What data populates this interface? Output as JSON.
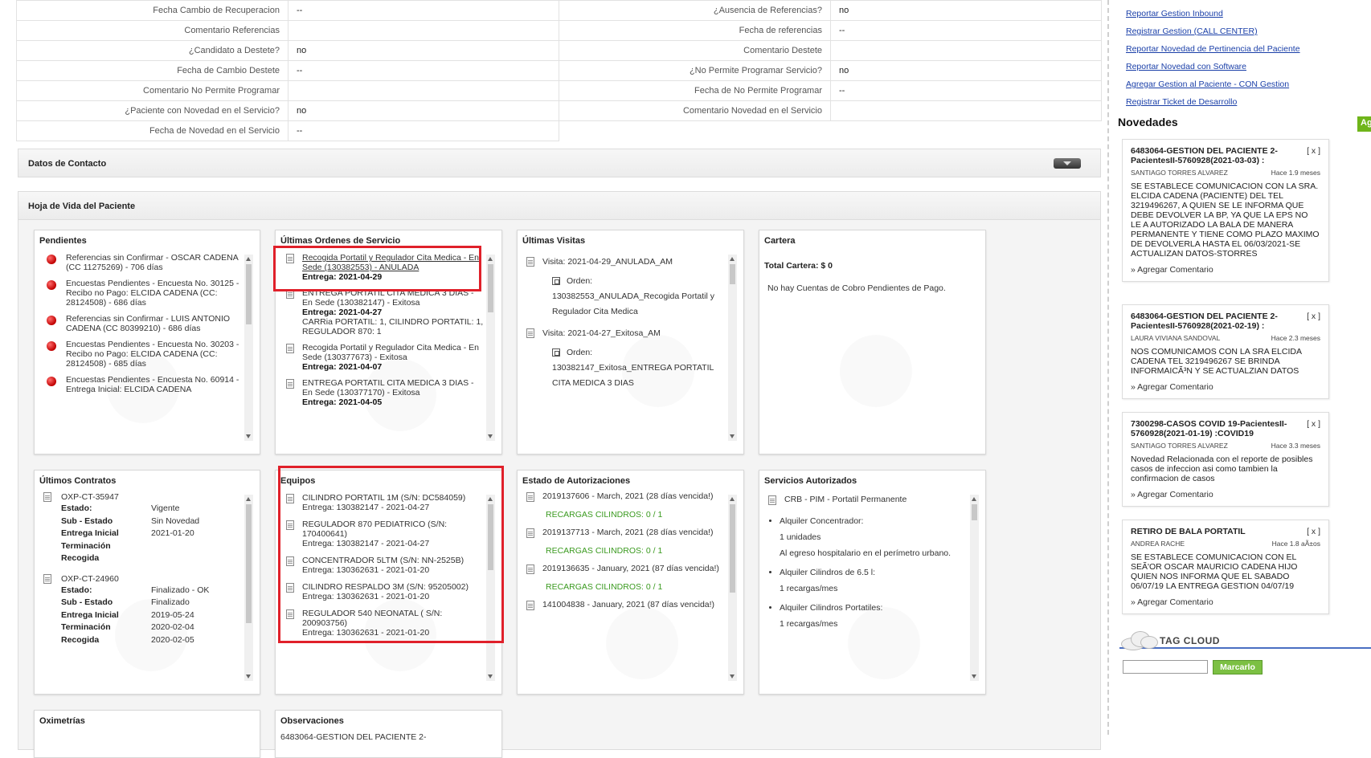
{
  "info_rows": [
    {
      "l1": "Fecha Cambio de Recuperacion",
      "v1": "--",
      "l2": "¿Ausencia de Referencias?",
      "v2": "no"
    },
    {
      "l1": "Comentario Referencias",
      "v1": "",
      "l2": "Fecha de referencias",
      "v2": "--"
    },
    {
      "l1": "¿Candidato a Destete?",
      "v1": "no",
      "l2": "Comentario Destete",
      "v2": ""
    },
    {
      "l1": "Fecha de Cambio Destete",
      "v1": "--",
      "l2": "¿No Permite Programar Servicio?",
      "v2": "no"
    },
    {
      "l1": "Comentario No Permite Programar",
      "v1": "",
      "l2": "Fecha de No Permite Programar",
      "v2": "--"
    },
    {
      "l1": "¿Paciente con Novedad en el Servicio?",
      "v1": "no",
      "l2": "Comentario Novedad en el Servicio",
      "v2": ""
    },
    {
      "l1": "Fecha de Novedad en el Servicio",
      "v1": "--"
    }
  ],
  "sections": {
    "datos_contacto": "Datos de Contacto",
    "hoja_vida": "Hoja de Vida del Paciente"
  },
  "pendientes": {
    "title": "Pendientes",
    "items": [
      "Referencias sin Confirmar - OSCAR CADENA (CC 11275269) - 706 días",
      "Encuestas Pendientes - Encuesta No. 30125 - Recibo no Pago: ELCIDA CADENA (CC: 28124508) - 686 días",
      "Referencias sin Confirmar - LUIS ANTONIO CADENA (CC 80399210) - 686 días",
      "Encuestas Pendientes - Encuesta No. 30203 - Recibo no Pago: ELCIDA CADENA (CC: 28124508) - 685 días",
      "Encuestas Pendientes - Encuesta No. 60914 - Entrega Inicial: ELCIDA CADENA"
    ]
  },
  "ordenes": {
    "title": "Últimas Ordenes de Servicio",
    "items": [
      {
        "desc": "Recogida Portatil y Regulador Cita Medica - En Sede (130382553) - ANULADA",
        "entrega": "Entrega: 2021-04-29",
        "extra": ""
      },
      {
        "desc": "ENTREGA PORTATIL CITA MEDICA 3 DIAS - En Sede (130382147) - Exitosa",
        "entrega": "Entrega: 2021-04-27",
        "extra": "CARRia PORTATIL: 1, CILINDRO PORTATIL: 1, REGULADOR 870: 1"
      },
      {
        "desc": "Recogida Portatil y Regulador Cita Medica - En Sede (130377673) - Exitosa",
        "entrega": "Entrega: 2021-04-07",
        "extra": ""
      },
      {
        "desc": "ENTREGA PORTATIL CITA MEDICA 3 DIAS - En Sede (130377170) - Exitosa",
        "entrega": "Entrega: 2021-04-05",
        "extra": ""
      }
    ]
  },
  "visitas": {
    "title": "Últimas Visitas",
    "items": [
      {
        "visita": "Visita: 2021-04-29_ANULADA_AM",
        "orden_label": "Orden:",
        "orden": "130382553_ANULADA_Recogida Portatil y Regulador Cita Medica"
      },
      {
        "visita": "Visita: 2021-04-27_Exitosa_AM",
        "orden_label": "Orden:",
        "orden": "130382147_Exitosa_ENTREGA PORTATIL CITA MEDICA 3 DIAS"
      }
    ]
  },
  "cartera": {
    "title": "Cartera",
    "total": "Total Cartera: $ 0",
    "msg": "No hay Cuentas de Cobro Pendientes de Pago."
  },
  "contratos": {
    "title": "Últimos Contratos",
    "items": [
      {
        "code": "OXP-CT-35947",
        "rows": [
          [
            "Estado:",
            "Vigente"
          ],
          [
            "Sub - Estado",
            "Sin Novedad"
          ],
          [
            "Entrega Inicial",
            "2021-01-20"
          ],
          [
            "Terminación",
            ""
          ],
          [
            "Recogida",
            ""
          ]
        ]
      },
      {
        "code": "OXP-CT-24960",
        "rows": [
          [
            "Estado:",
            "Finalizado - OK"
          ],
          [
            "Sub - Estado",
            "Finalizado"
          ],
          [
            "Entrega Inicial",
            "2019-05-24"
          ],
          [
            "Terminación",
            "2020-02-04"
          ],
          [
            "Recogida",
            "2020-02-05"
          ]
        ]
      }
    ]
  },
  "equipos": {
    "title": "Equipos",
    "items": [
      {
        "name": "CILINDRO PORTATIL 1M (S/N: DC584059)",
        "entrega": "Entrega: 130382147 - 2021-04-27"
      },
      {
        "name": "REGULADOR 870 PEDIATRICO (S/N: 170400641)",
        "entrega": "Entrega: 130382147 - 2021-04-27"
      },
      {
        "name": "CONCENTRADOR 5LTM (S/N: NN-2525B)",
        "entrega": "Entrega: 130362631 - 2021-01-20"
      },
      {
        "name": "CILINDRO RESPALDO 3M (S/N: 95205002)",
        "entrega": "Entrega: 130362631 - 2021-01-20"
      },
      {
        "name": "REGULADOR 540 NEONATAL ( S/N: 200903756)",
        "entrega": "Entrega: 130362631 - 2021-01-20"
      }
    ]
  },
  "autorizaciones": {
    "title": "Estado de Autorizaciones",
    "items": [
      {
        "text": "2019137606 - March, 2021 (28 días vencida!)",
        "recargas": "RECARGAS CILINDROS: 0 / 1"
      },
      {
        "text": "2019137713 - March, 2021 (28 días vencida!)",
        "recargas": "RECARGAS CILINDROS: 0 / 1"
      },
      {
        "text": "2019136635 - January, 2021 (87 días vencida!)",
        "recargas": "RECARGAS CILINDROS: 0 / 1"
      },
      {
        "text": "141004838 - January, 2021 (87 días vencida!)",
        "recargas": ""
      }
    ]
  },
  "servicios": {
    "title": "Servicios Autorizados",
    "header": "CRB - PIM - Portatil Permanente",
    "items": [
      {
        "name": "Alquiler Concentrador:",
        "lines": [
          "1 unidades",
          "Al egreso hospitalario en el perímetro urbano."
        ]
      },
      {
        "name": "Alquiler Cilindros de 6.5 l:",
        "lines": [
          "1 recargas/mes"
        ]
      },
      {
        "name": "Alquiler Cilindros Portatiles:",
        "lines": [
          "1 recargas/mes"
        ]
      }
    ]
  },
  "bottom_cards": {
    "oximetrias": "Oximetrías",
    "observaciones": "Observaciones",
    "observaciones_preview": "6483064-GESTION DEL PACIENTE 2-"
  },
  "links": [
    "Reportar Gestion Inbound",
    "Registrar Gestion (CALL CENTER)",
    "Reportar Novedad de Pertinencia del Paciente",
    "Reportar Novedad con Software",
    "Agregar Gestion al Paciente - CON Gestion",
    "Registrar Ticket de Desarrollo"
  ],
  "novedades": {
    "title": "Novedades",
    "add_label": "Ag",
    "close_label": "[ x ]",
    "comment_label": "» Agregar Comentario",
    "items": [
      {
        "title": "6483064-GESTION DEL PACIENTE 2-PacientesII-5760928(2021-03-03) :",
        "author": "SANTIAGO TORRES ALVAREZ",
        "ago": "Hace 1.9 meses",
        "body": "SE ESTABLECE COMUNICACION CON LA SRA. ELCIDA CADENA (PACIENTE) DEL TEL 3219496267, A QUIEN SE LE INFORMA QUE DEBE DEVOLVER LA BP, YA QUE LA EPS NO LE A AUTORIZADO LA BALA DE MANERA PERMANENTE Y TIENE COMO PLAZO MAXIMO DE DEVOLVERLA HASTA EL 06/03/2021-SE ACTUALIZAN DATOS-STORRES"
      },
      {
        "title": "6483064-GESTION DEL PACIENTE 2-PacientesII-5760928(2021-02-19) :",
        "author": "LAURA VIVIANA SANDOVAL",
        "ago": "Hace 2.3 meses",
        "body": "NOS COMUNICAMOS CON LA SRA ELCIDA CADENA TEL 3219496267 SE BRINDA INFORMAICÃ³N Y SE ACTUALZIAN DATOS"
      },
      {
        "title": "7300298-CASOS COVID 19-PacientesII-5760928(2021-01-19) :COVID19",
        "author": "SANTIAGO TORRES ALVAREZ",
        "ago": "Hace 3.3 meses",
        "body": "Novedad Relacionada con el reporte de posibles casos de infeccion asi como tambien la confirmacion de casos"
      },
      {
        "title": "RETIRO DE BALA PORTATIL",
        "author": "ANDREA RACHE",
        "ago": "Hace 1.8 aÃ±os",
        "body": "SE ESTABLECE COMUNICACION CON EL SEÃ'OR OSCAR MAURICIO CADENA HIJO QUIEN NOS INFORMA QUE EL SABADO 06/07/19 LA ENTREGA GESTION 04/07/19"
      }
    ]
  },
  "tag_cloud": {
    "title": "TAG CLOUD",
    "button": "Marcarlo",
    "input_value": ""
  },
  "colors": {
    "link": "#1a3fa8",
    "green_text": "#3a9a1f",
    "highlight_red": "#e0202a",
    "pending_dot": "#c00000",
    "tag_button": "#7cc043"
  }
}
